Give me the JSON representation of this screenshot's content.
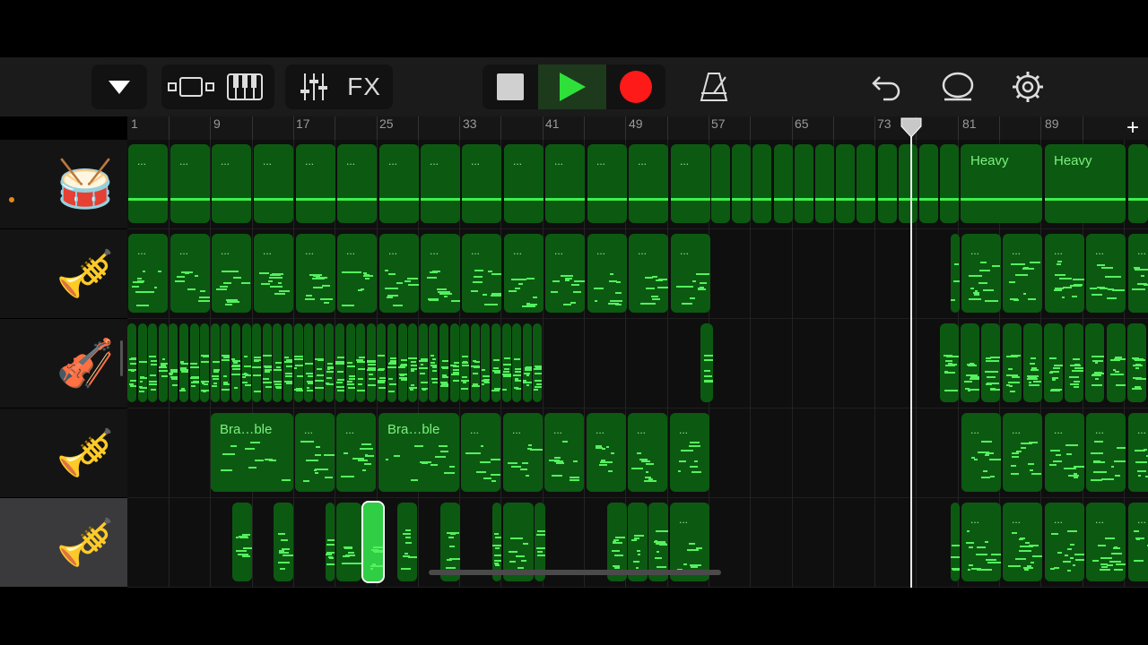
{
  "toolbar": {
    "fx_label": "FX",
    "icons": [
      "tracks-dropdown-icon",
      "view-toggle-icon",
      "keyboard-icon",
      "mixer-icon",
      "stop-icon",
      "play-icon",
      "record-icon",
      "metronome-icon",
      "undo-icon",
      "loop-icon",
      "settings-icon"
    ]
  },
  "ruler": {
    "labels": [
      "1",
      "9",
      "17",
      "25",
      "33",
      "41",
      "49",
      "57",
      "65",
      "73",
      "81",
      "89"
    ],
    "add_label": "+"
  },
  "tracks": [
    {
      "name": "drums-track",
      "icon": "🥁",
      "selected": false,
      "active_marker": true
    },
    {
      "name": "brass-track-1",
      "icon": "🎺",
      "selected": false,
      "active_marker": false
    },
    {
      "name": "strings-track",
      "icon": "🎻",
      "selected": false,
      "active_marker": false
    },
    {
      "name": "brass-track-2",
      "icon": "🎺",
      "selected": false,
      "active_marker": false
    },
    {
      "name": "brass-track-3",
      "icon": "🎺",
      "selected": true,
      "active_marker": false
    }
  ],
  "regions": {
    "dots": "...",
    "heavy_label_1": "Heavy",
    "heavy_label_2": "Heavy",
    "bra_label_1": "Bra…ble",
    "bra_label_2": "Bra…ble"
  },
  "colors": {
    "region": "#0c5a12",
    "note": "#55f05f",
    "record": "#ff1a1a",
    "play": "#2fe03a"
  }
}
